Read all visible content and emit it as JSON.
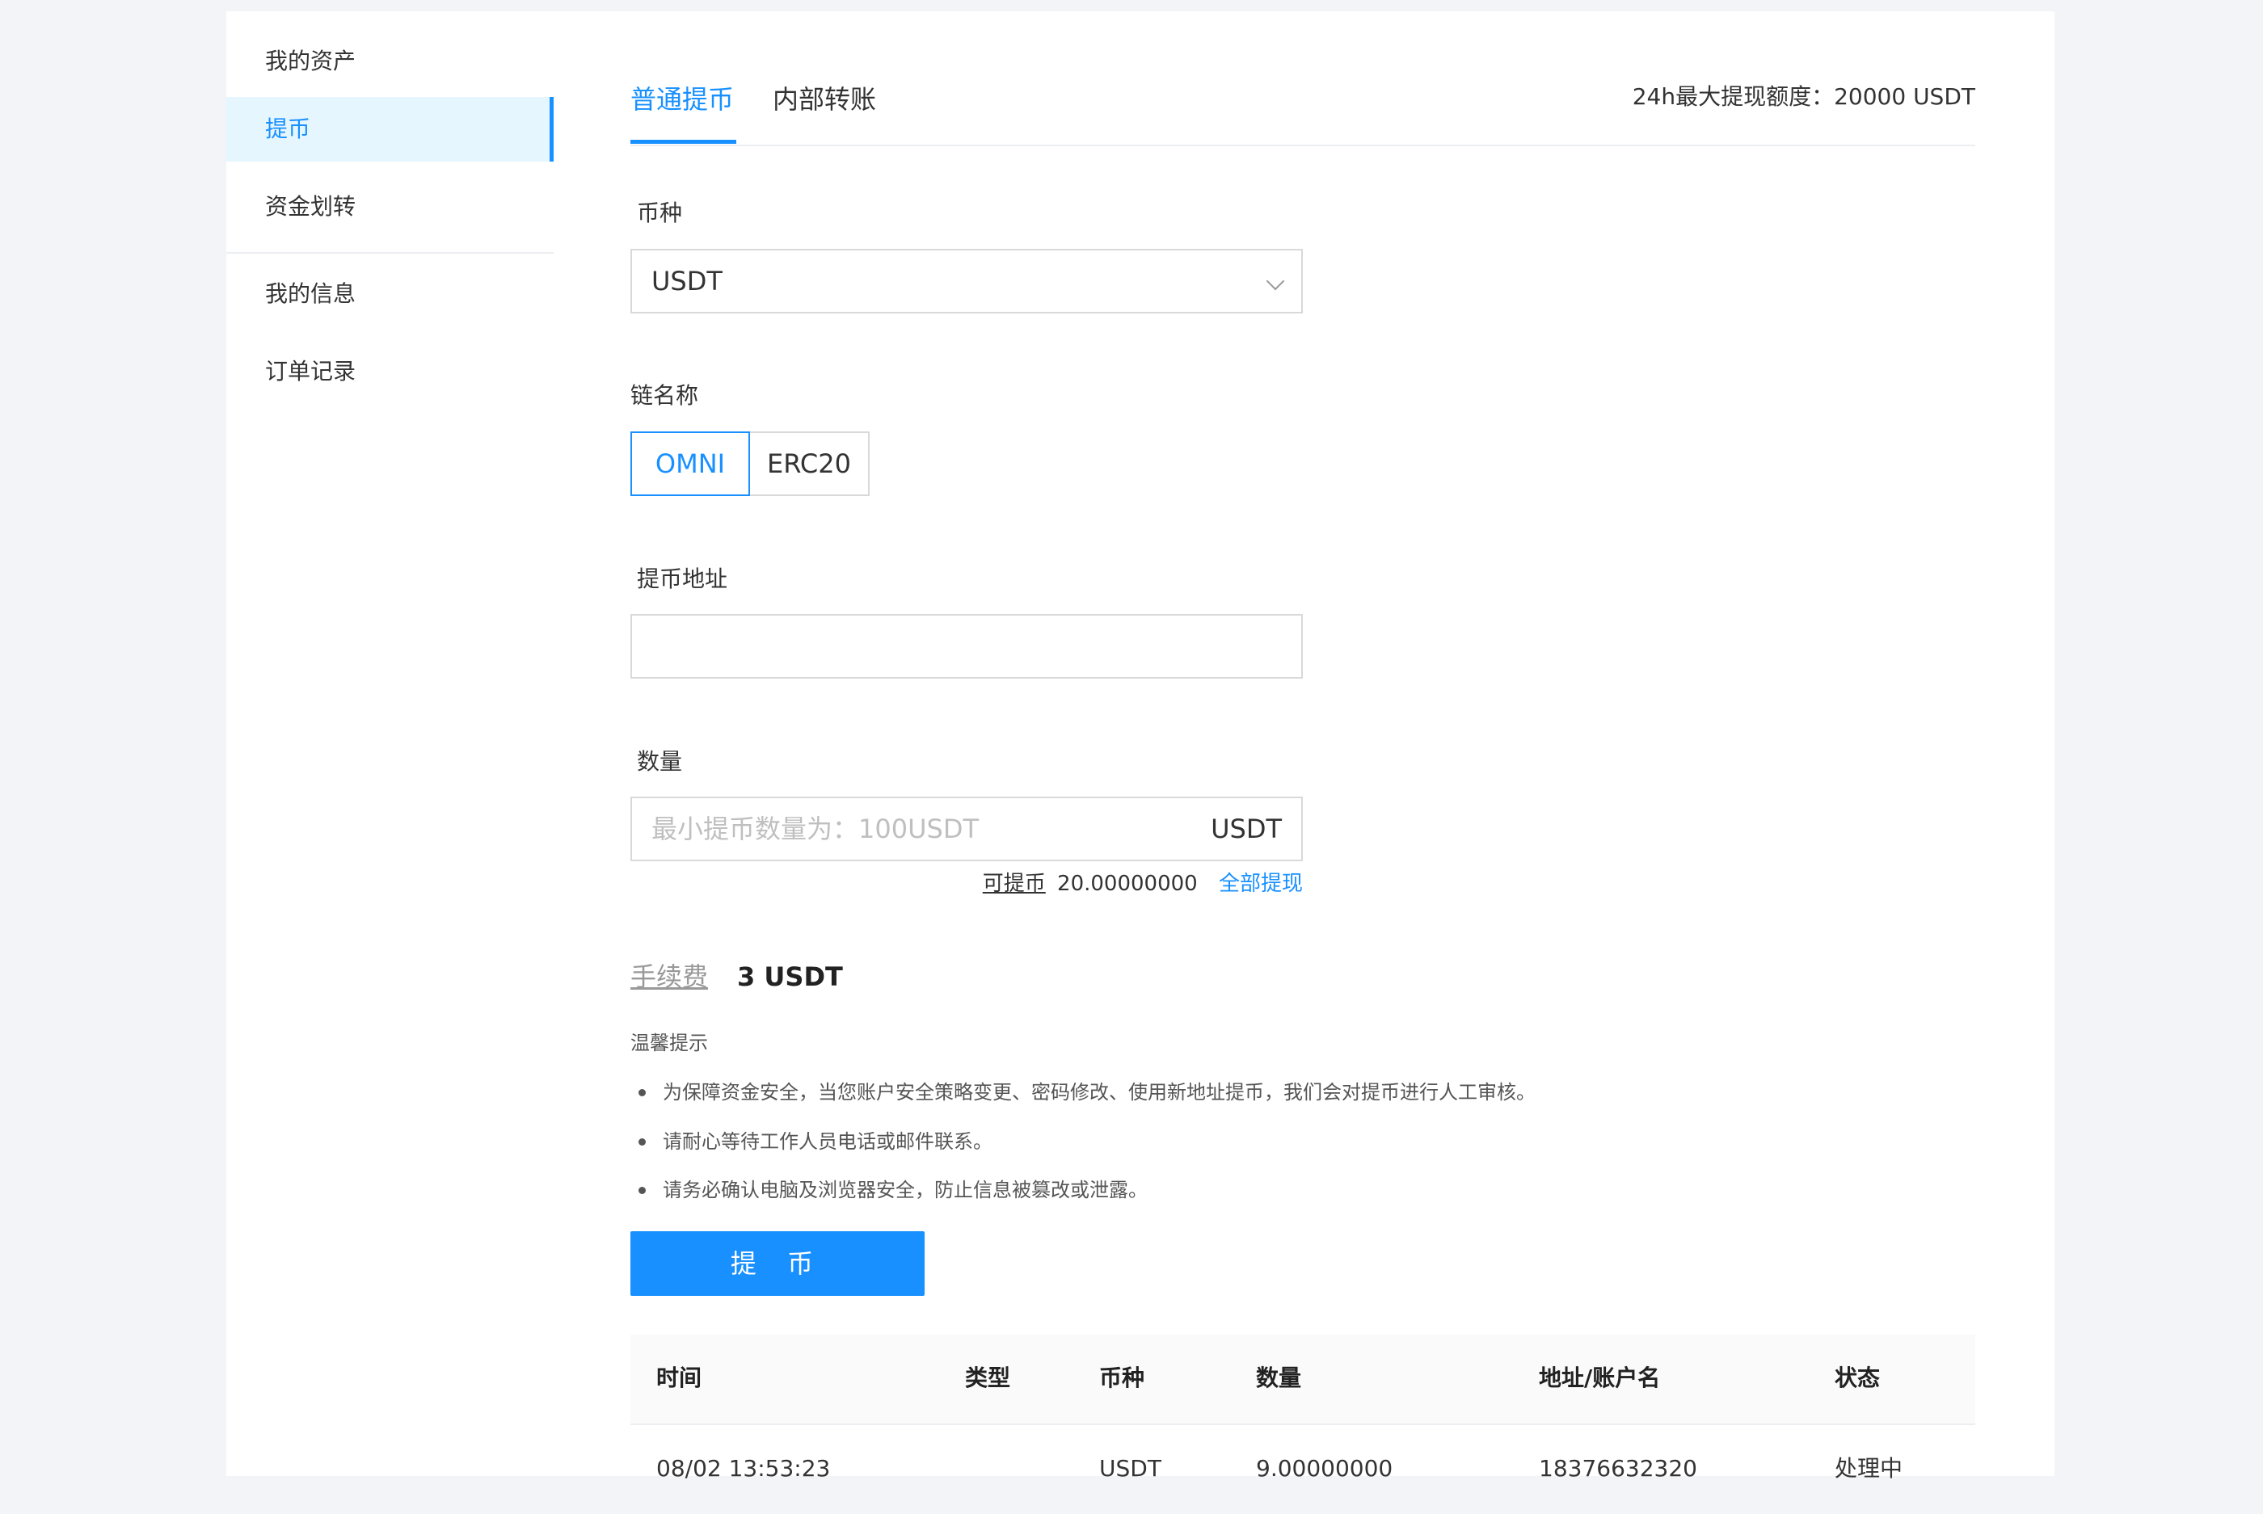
{
  "sidebar": {
    "items": [
      {
        "label": "我的资产"
      },
      {
        "label": "提币"
      },
      {
        "label": "资金划转"
      },
      {
        "label": "我的信息"
      },
      {
        "label": "订单记录"
      }
    ]
  },
  "tabs": [
    {
      "label": "普通提币"
    },
    {
      "label": "内部转账"
    }
  ],
  "limit_text": "24h最大提现额度：20000 USDT",
  "form": {
    "coin_label": "币种",
    "coin_value": "USDT",
    "chain_label": "链名称",
    "chains": [
      "OMNI",
      "ERC20"
    ],
    "address_label": "提币地址",
    "address_value": "",
    "amount_label": "数量",
    "amount_placeholder": "最小提币数量为：100USDT",
    "amount_suffix": "USDT",
    "available_label": "可提币",
    "available_value": "20.00000000",
    "withdraw_all": "全部提现",
    "fee_label": "手续费",
    "fee_value": "3 USDT"
  },
  "tips": {
    "title": "温馨提示",
    "items": [
      "为保障资金安全，当您账户安全策略变更、密码修改、使用新地址提币，我们会对提币进行人工审核。",
      "请耐心等待工作人员电话或邮件联系。",
      "请务必确认电脑及浏览器安全，防止信息被篡改或泄露。"
    ]
  },
  "submit_label": "提 币",
  "table": {
    "headers": [
      "时间",
      "类型",
      "币种",
      "数量",
      "地址/账户名",
      "状态"
    ],
    "rows": [
      {
        "time": "08/02 13:53:23",
        "type": "",
        "coin": "USDT",
        "amount": "9.00000000",
        "address": "18376632320",
        "status": "处理中"
      }
    ]
  },
  "colors": {
    "accent": "#1890ff",
    "background": "#f3f4f7"
  }
}
